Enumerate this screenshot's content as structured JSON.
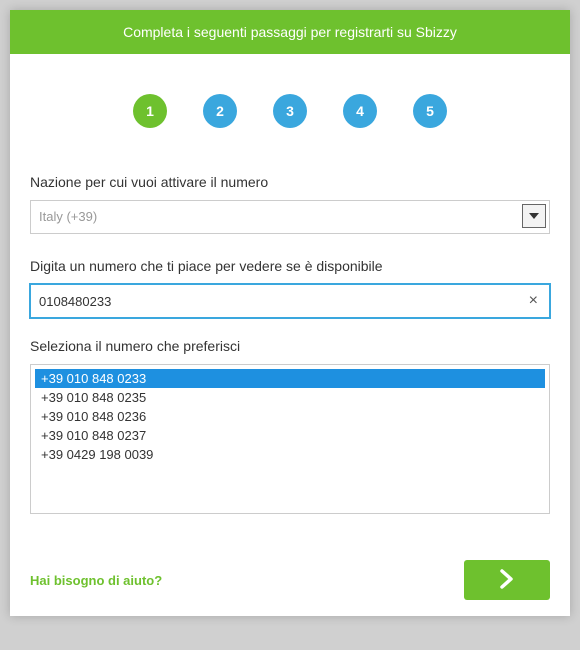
{
  "header": {
    "title": "Completa i seguenti passaggi per registrarti su Sbizzy"
  },
  "stepper": {
    "steps": [
      "1",
      "2",
      "3",
      "4",
      "5"
    ],
    "active_index": 0
  },
  "form": {
    "country_label": "Nazione per cui vuoi attivare il numero",
    "country_selected": "Italy (+39)",
    "number_label": "Digita un numero che ti piace per vedere se è disponibile",
    "number_value": "0108480233",
    "clear_glyph": "×",
    "list_label": "Seleziona il numero che preferisci",
    "numbers": [
      "+39 010 848 0233",
      "+39 010 848 0235",
      "+39 010 848 0236",
      "+39 010 848 0237",
      "+39 0429 198 0039"
    ],
    "selected_number_index": 0
  },
  "footer": {
    "help_text": "Hai bisogno di aiuto?"
  },
  "colors": {
    "primary_green": "#6ec12e",
    "step_blue": "#3aa7de"
  }
}
